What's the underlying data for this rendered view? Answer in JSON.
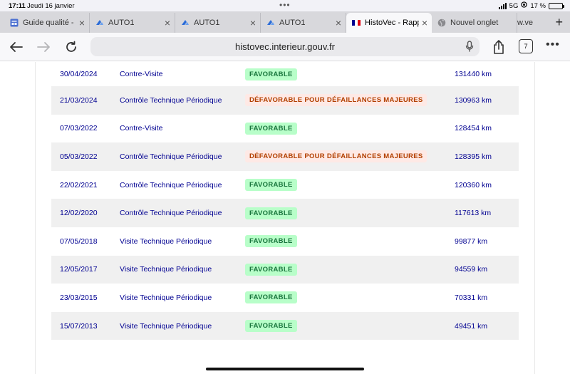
{
  "status": {
    "time": "17:11",
    "date": "Jeudi 16 janvier",
    "network": "5G",
    "battery": "17 %",
    "battery_level": 0.17
  },
  "tabs": [
    {
      "label": "Guide qualité -",
      "icon": "document-icon"
    },
    {
      "label": "AUTO1",
      "icon": "auto1-logo-icon"
    },
    {
      "label": "AUTO1",
      "icon": "auto1-logo-icon"
    },
    {
      "label": "AUTO1",
      "icon": "auto1-logo-icon"
    },
    {
      "label": "HistoVec - Rapp",
      "icon": "french-flag-icon",
      "active": true
    },
    {
      "label": "Nouvel onglet",
      "icon": "globe-icon"
    }
  ],
  "partial_tab": "w.ve",
  "address_bar": {
    "url": "histovec.interieur.gouv.fr",
    "tab_count": "7"
  },
  "history": {
    "rows": [
      {
        "date": "30/04/2024",
        "type": "Contre-Visite",
        "result": "FAVORABLE",
        "status": "ok",
        "km": "131440 km"
      },
      {
        "date": "21/03/2024",
        "type": "Contrôle Technique Périodique",
        "result": "DÉFAVORABLE POUR DÉFAILLANCES MAJEURES",
        "status": "ko",
        "km": "130963 km"
      },
      {
        "date": "07/03/2022",
        "type": "Contre-Visite",
        "result": "FAVORABLE",
        "status": "ok",
        "km": "128454 km"
      },
      {
        "date": "05/03/2022",
        "type": "Contrôle Technique Périodique",
        "result": "DÉFAVORABLE POUR DÉFAILLANCES MAJEURES",
        "status": "ko",
        "km": "128395 km"
      },
      {
        "date": "22/02/2021",
        "type": "Contrôle Technique Périodique",
        "result": "FAVORABLE",
        "status": "ok",
        "km": "120360 km"
      },
      {
        "date": "12/02/2020",
        "type": "Contrôle Technique Périodique",
        "result": "FAVORABLE",
        "status": "ok",
        "km": "117613 km"
      },
      {
        "date": "07/05/2018",
        "type": "Visite Technique Périodique",
        "result": "FAVORABLE",
        "status": "ok",
        "km": "99877 km"
      },
      {
        "date": "12/05/2017",
        "type": "Visite Technique Périodique",
        "result": "FAVORABLE",
        "status": "ok",
        "km": "94559 km"
      },
      {
        "date": "23/03/2015",
        "type": "Visite Technique Périodique",
        "result": "FAVORABLE",
        "status": "ok",
        "km": "70331 km"
      },
      {
        "date": "15/07/2013",
        "type": "Visite Technique Périodique",
        "result": "FAVORABLE",
        "status": "ok",
        "km": "49451 km"
      }
    ]
  },
  "colors": {
    "accent_blue": "#000091",
    "favorable_bg": "#b8fec9",
    "favorable_text": "#18753c",
    "defavorable_bg": "#fee9e5",
    "defavorable_text": "#b34000"
  }
}
